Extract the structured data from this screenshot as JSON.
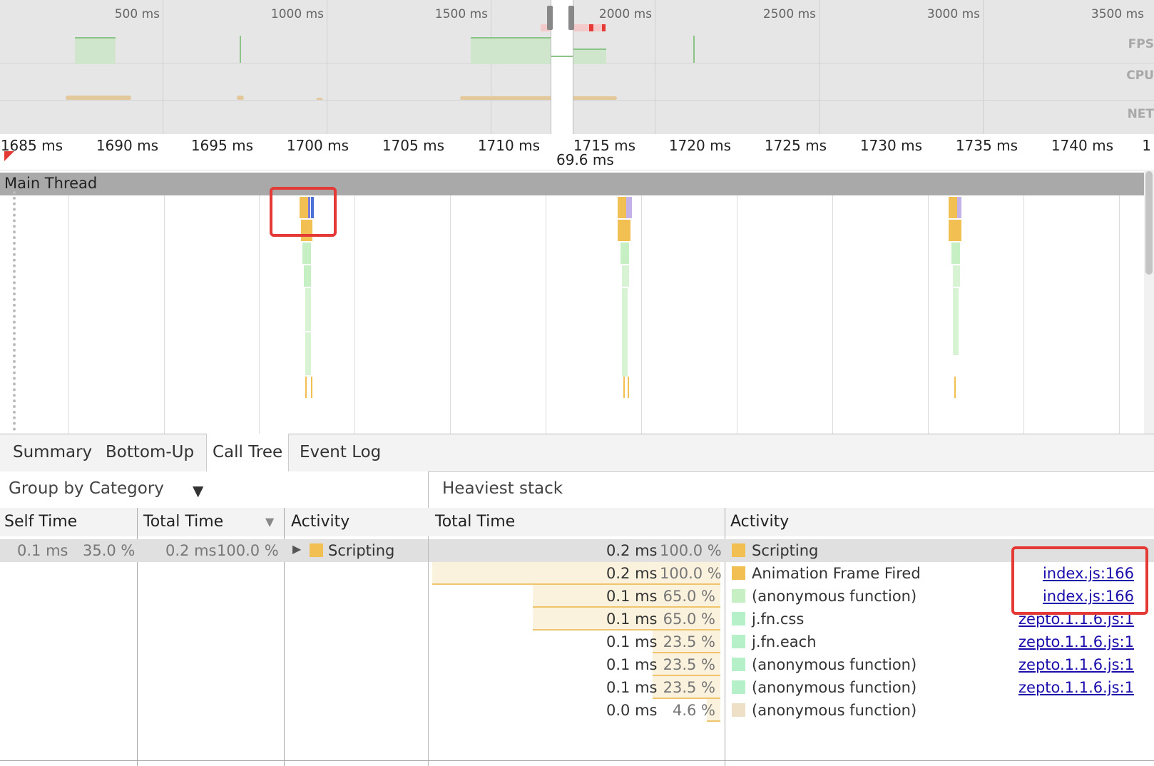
{
  "overview": {
    "ticks": [
      "500 ms",
      "1000 ms",
      "1500 ms",
      "2000 ms",
      "2500 ms",
      "3000 ms",
      "3500 ms"
    ],
    "lanes": [
      "FPS",
      "CPU",
      "NET"
    ]
  },
  "ruler": {
    "ticks": [
      "1685 ms",
      "1690 ms",
      "1695 ms",
      "1700 ms",
      "1705 ms",
      "1710 ms",
      "1715 ms",
      "1720 ms",
      "1725 ms",
      "1730 ms",
      "1735 ms",
      "1740 ms",
      "1"
    ],
    "duration": "69.6 ms"
  },
  "main_thread": {
    "title": "Main Thread"
  },
  "tabs": [
    "Summary",
    "Bottom-Up",
    "Call Tree",
    "Event Log"
  ],
  "active_tab": "Call Tree",
  "left": {
    "group_by": "Group by Category",
    "columns": {
      "self_time": "Self Time",
      "total_time": "Total Time",
      "activity": "Activity"
    },
    "row": {
      "self_ms": "0.1 ms",
      "self_pct": "35.0 %",
      "total_ms": "0.2 ms",
      "total_pct": "100.0 %",
      "activity": "Scripting",
      "color": "#f2c052"
    }
  },
  "right": {
    "title": "Heaviest stack",
    "columns": {
      "total_time": "Total Time",
      "activity": "Activity"
    },
    "rows": [
      {
        "ms": "0.2 ms",
        "pct": "100.0 %",
        "fraction": 1.0,
        "activity": "Scripting",
        "link": "",
        "color": "#f2c052"
      },
      {
        "ms": "0.2 ms",
        "pct": "100.0 %",
        "fraction": 1.0,
        "activity": "Animation Frame Fired",
        "link": "index.js:166",
        "color": "#f2c052"
      },
      {
        "ms": "0.1 ms",
        "pct": "65.0 %",
        "fraction": 0.65,
        "activity": "(anonymous function)",
        "link": "index.js:166",
        "color": "#c6efc3"
      },
      {
        "ms": "0.1 ms",
        "pct": "65.0 %",
        "fraction": 0.65,
        "activity": "j.fn.css",
        "link": "zepto.1.1.6.js:1",
        "color": "#b6f0c8"
      },
      {
        "ms": "0.1 ms",
        "pct": "23.5 %",
        "fraction": 0.235,
        "activity": "j.fn.each",
        "link": "zepto.1.1.6.js:1",
        "color": "#b6f0c8"
      },
      {
        "ms": "0.1 ms",
        "pct": "23.5 %",
        "fraction": 0.235,
        "activity": "(anonymous function)",
        "link": "zepto.1.1.6.js:1",
        "color": "#b6f0c8"
      },
      {
        "ms": "0.1 ms",
        "pct": "23.5 %",
        "fraction": 0.235,
        "activity": "(anonymous function)",
        "link": "zepto.1.1.6.js:1",
        "color": "#b6f0c8"
      },
      {
        "ms": "0.0 ms",
        "pct": "4.6 %",
        "fraction": 0.046,
        "activity": "(anonymous function)",
        "link": "",
        "color": "#eee0c6"
      }
    ]
  }
}
